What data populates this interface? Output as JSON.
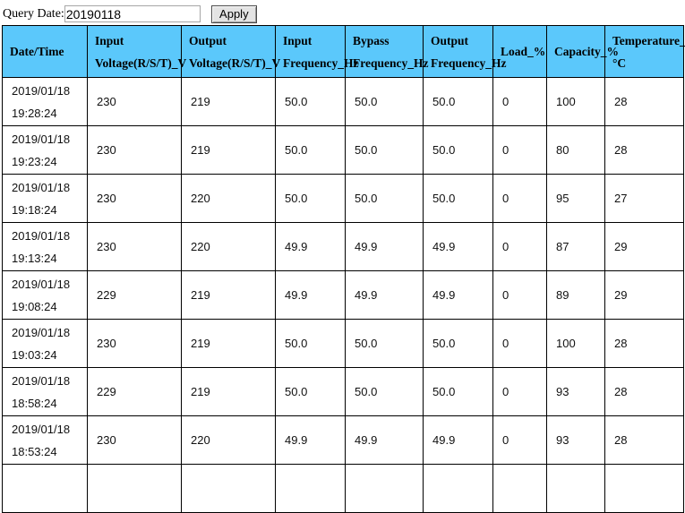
{
  "query": {
    "label": "Query Date:",
    "value": "20190118",
    "placeholder": "",
    "apply_label": "Apply"
  },
  "table": {
    "header_bg": "#5BC8FB",
    "columns": [
      {
        "line1": "Date/Time",
        "line2": "",
        "single": true
      },
      {
        "line1": "Input",
        "line2": "Voltage(R/S/T)_V",
        "single": false
      },
      {
        "line1": "Output",
        "line2": "Voltage(R/S/T)_V",
        "single": false
      },
      {
        "line1": "Input",
        "line2": "Frequency_Hz",
        "single": false
      },
      {
        "line1": "Bypass",
        "line2": "Frequency_Hz",
        "single": false
      },
      {
        "line1": "Output",
        "line2": "Frequency_Hz",
        "single": false
      },
      {
        "line1": "Load_%",
        "line2": "",
        "single": true
      },
      {
        "line1": "Capacity_%",
        "line2": "",
        "single": true
      },
      {
        "line1": "Temperature_",
        "line2": "°C",
        "single": false
      }
    ],
    "rows": [
      {
        "date": "2019/01/18",
        "time": "19:28:24",
        "input_voltage": "230",
        "output_voltage": "219",
        "input_freq": "50.0",
        "bypass_freq": "50.0",
        "output_freq": "50.0",
        "load": "0",
        "capacity": "100",
        "temperature": "28"
      },
      {
        "date": "2019/01/18",
        "time": "19:23:24",
        "input_voltage": "230",
        "output_voltage": "219",
        "input_freq": "50.0",
        "bypass_freq": "50.0",
        "output_freq": "50.0",
        "load": "0",
        "capacity": "80",
        "temperature": "28"
      },
      {
        "date": "2019/01/18",
        "time": "19:18:24",
        "input_voltage": "230",
        "output_voltage": "220",
        "input_freq": "50.0",
        "bypass_freq": "50.0",
        "output_freq": "50.0",
        "load": "0",
        "capacity": "95",
        "temperature": "27"
      },
      {
        "date": "2019/01/18",
        "time": "19:13:24",
        "input_voltage": "230",
        "output_voltage": "220",
        "input_freq": "49.9",
        "bypass_freq": "49.9",
        "output_freq": "49.9",
        "load": "0",
        "capacity": "87",
        "temperature": "29"
      },
      {
        "date": "2019/01/18",
        "time": "19:08:24",
        "input_voltage": "229",
        "output_voltage": "219",
        "input_freq": "49.9",
        "bypass_freq": "49.9",
        "output_freq": "49.9",
        "load": "0",
        "capacity": "89",
        "temperature": "29"
      },
      {
        "date": "2019/01/18",
        "time": "19:03:24",
        "input_voltage": "230",
        "output_voltage": "219",
        "input_freq": "50.0",
        "bypass_freq": "50.0",
        "output_freq": "50.0",
        "load": "0",
        "capacity": "100",
        "temperature": "28"
      },
      {
        "date": "2019/01/18",
        "time": "18:58:24",
        "input_voltage": "229",
        "output_voltage": "219",
        "input_freq": "50.0",
        "bypass_freq": "50.0",
        "output_freq": "50.0",
        "load": "0",
        "capacity": "93",
        "temperature": "28"
      },
      {
        "date": "2019/01/18",
        "time": "18:53:24",
        "input_voltage": "230",
        "output_voltage": "220",
        "input_freq": "49.9",
        "bypass_freq": "49.9",
        "output_freq": "49.9",
        "load": "0",
        "capacity": "93",
        "temperature": "28"
      },
      {
        "date": "",
        "time": "",
        "input_voltage": "",
        "output_voltage": "",
        "input_freq": "",
        "bypass_freq": "",
        "output_freq": "",
        "load": "",
        "capacity": "",
        "temperature": ""
      }
    ]
  }
}
